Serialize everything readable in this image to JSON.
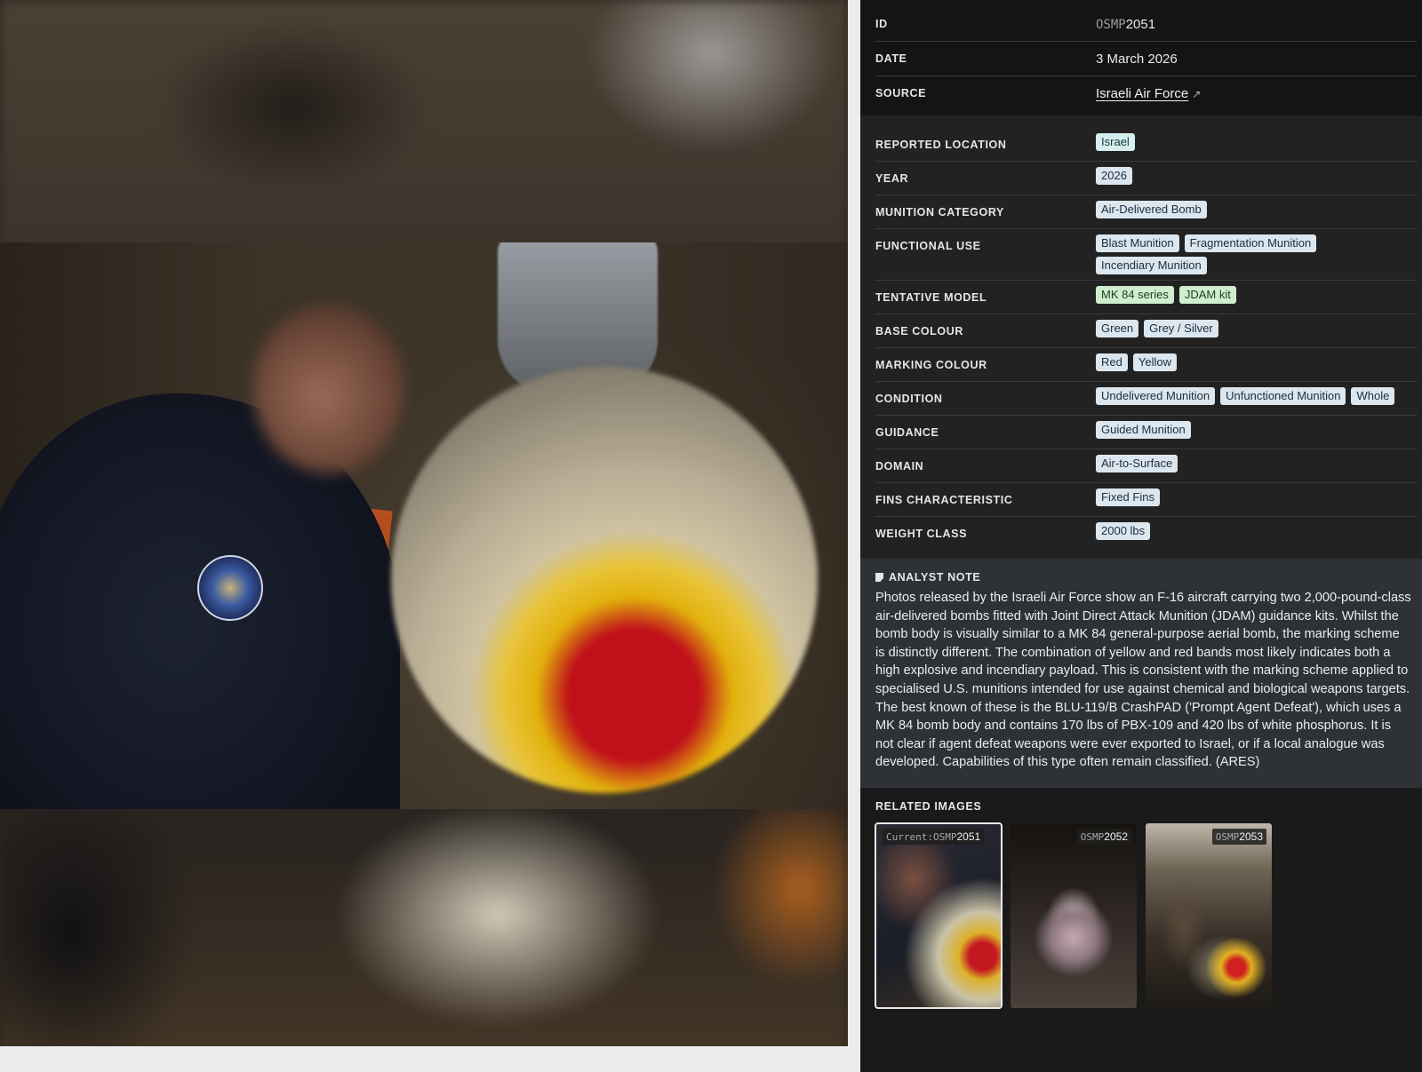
{
  "meta": {
    "id_label": "ID",
    "id_prefix": "OSMP",
    "id_number": "2051",
    "date_label": "DATE",
    "date_value": "3 March 2026",
    "source_label": "SOURCE",
    "source_value": "Israeli Air Force",
    "source_icon": "external-link-icon"
  },
  "attributes": {
    "reported_location": {
      "label": "REPORTED LOCATION",
      "tags": [
        "Israel"
      ]
    },
    "year": {
      "label": "YEAR",
      "tags": [
        "2026"
      ]
    },
    "munition_category": {
      "label": "MUNITION CATEGORY",
      "tags": [
        "Air-Delivered Bomb"
      ]
    },
    "functional_use": {
      "label": "FUNCTIONAL USE",
      "tags": [
        "Blast Munition",
        "Fragmentation Munition",
        "Incendiary Munition"
      ]
    },
    "tentative_model": {
      "label": "TENTATIVE MODEL",
      "tags": [
        "MK 84 series",
        "JDAM kit"
      ]
    },
    "base_colour": {
      "label": "BASE COLOUR",
      "tags": [
        "Green",
        "Grey / Silver"
      ]
    },
    "marking_colour": {
      "label": "MARKING COLOUR",
      "tags": [
        "Red",
        "Yellow"
      ]
    },
    "condition": {
      "label": "CONDITION",
      "tags": [
        "Undelivered Munition",
        "Unfunctioned Munition",
        "Whole"
      ]
    },
    "guidance": {
      "label": "GUIDANCE",
      "tags": [
        "Guided Munition"
      ]
    },
    "domain": {
      "label": "DOMAIN",
      "tags": [
        "Air-to-Surface"
      ]
    },
    "fins_characteristic": {
      "label": "FINS CHARACTERISTIC",
      "tags": [
        "Fixed Fins"
      ]
    },
    "weight_class": {
      "label": "WEIGHT CLASS",
      "tags": [
        "2000 lbs"
      ]
    }
  },
  "analyst_note": {
    "title": "ANALYST NOTE",
    "icon": "note-icon",
    "text": "Photos released by the Israeli Air Force show an F-16 aircraft carrying two 2,000-pound-class air-delivered bombs fitted with Joint Direct Attack Munition (JDAM) guidance kits. Whilst the bomb body is visually similar to a MK 84 general-purpose aerial bomb, the marking scheme is distinctly different. The combination of yellow and red bands most likely indicates both a high explosive and incendiary payload. This is consistent with the marking scheme applied to specialised U.S. munitions intended for use against chemical and biological weapons targets. The best known of these is the BLU-119/B CrashPAD ('Prompt Agent Defeat'), which uses a MK 84 bomb body and contains 170 lbs of PBX-109 and 420 lbs of white phosphorus. It is not clear if agent defeat weapons were ever exported to Israel, or if a local analogue was developed. Capabilities of this type often remain classified. (ARES)"
  },
  "related": {
    "title": "RELATED IMAGES",
    "items": [
      {
        "prefix_label": "Current:",
        "mono": "OSMP",
        "number": "2051",
        "current": true
      },
      {
        "prefix_label": "",
        "mono": "OSMP",
        "number": "2052",
        "current": false
      },
      {
        "prefix_label": "",
        "mono": "OSMP",
        "number": "2053",
        "current": false
      }
    ]
  },
  "colors": {
    "panel_bg": "#1a1a1a",
    "chip_default": "#dbe6ee",
    "chip_location": "#d7eeee",
    "chip_model": "#cfeecf",
    "note_bg": "#2e3236"
  }
}
